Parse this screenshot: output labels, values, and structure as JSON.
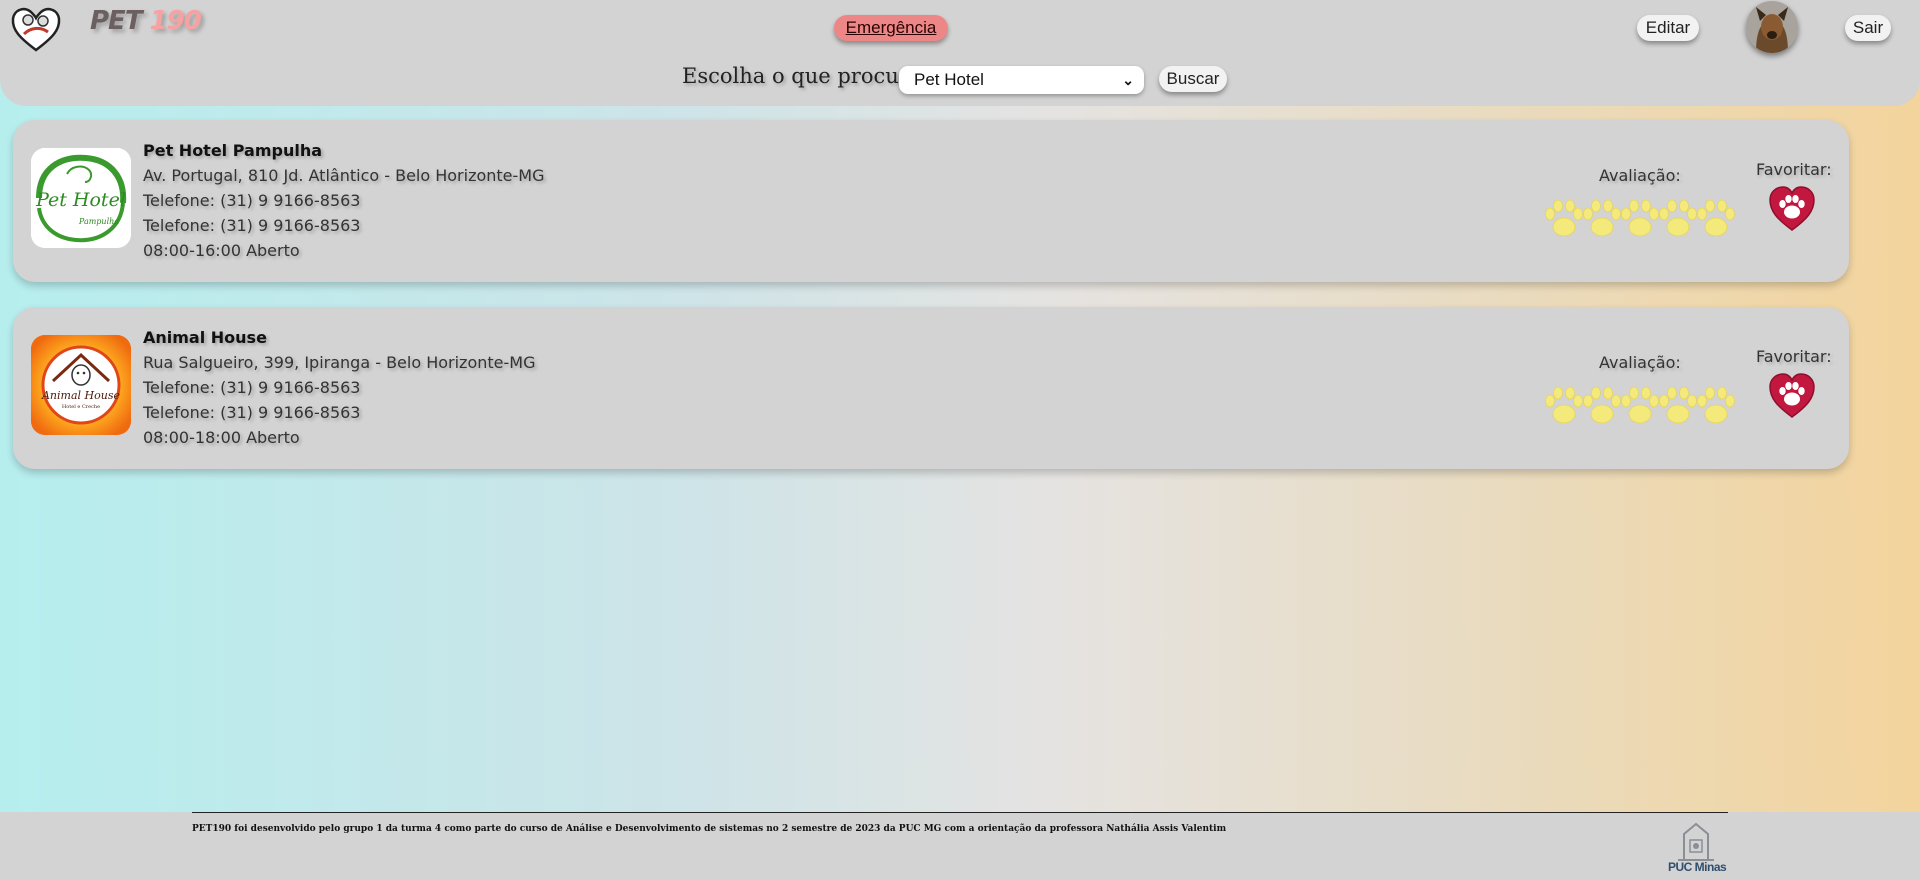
{
  "header": {
    "brand": {
      "part1": "PET",
      "part2": "190"
    },
    "emergency_label": "Emergência",
    "edit_label": "Editar",
    "logout_label": "Sair",
    "search": {
      "label": "Escolha o que procura:",
      "selected": "Pet Hotel",
      "button_label": "Buscar"
    }
  },
  "results": [
    {
      "name": "Pet Hotel Pampulha",
      "address": "Av. Portugal, 810 Jd. Atlântico - Belo Horizonte-MG",
      "phone1": "Telefone: (31) 9 9166-8563",
      "phone2": "Telefone: (31) 9 9166-8563",
      "hours": "08:00-16:00 Aberto",
      "rating_label": "Avaliação:",
      "rating": 5,
      "favorite_label": "Favoritar:",
      "logo_text": {
        "main": "Pet Hotel",
        "sub": "Pampulha"
      }
    },
    {
      "name": "Animal House",
      "address": "Rua Salgueiro, 399, Ipiranga - Belo Horizonte-MG",
      "phone1": "Telefone: (31) 9 9166-8563",
      "phone2": "Telefone: (31) 9 9166-8563",
      "hours": "08:00-18:00 Aberto",
      "rating_label": "Avaliação:",
      "rating": 5,
      "favorite_label": "Favoritar:",
      "logo_text": {
        "main": "Animal House",
        "sub": "Hotel e Creche"
      }
    }
  ],
  "footer": {
    "credit": "PET190 foi desenvolvido pelo grupo 1 da turma 4 como parte do curso de Análise e Desenvolvimento de sistemas no 2 semestre de 2023 da PUC MG com a orientação da professora Nathália Assis Valentim",
    "university_logo_text": "PUC Minas"
  },
  "colors": {
    "emergency": "#ed8787",
    "paw_rating": "#f4ea7c",
    "favorite_heart": "#c2173f",
    "panel": "#d3d3d3"
  },
  "icons": [
    "pet-heart-logo-icon",
    "paw-rating-icon",
    "paw-heart-favorite-icon",
    "chevron-down-icon",
    "puc-crest-icon"
  ]
}
